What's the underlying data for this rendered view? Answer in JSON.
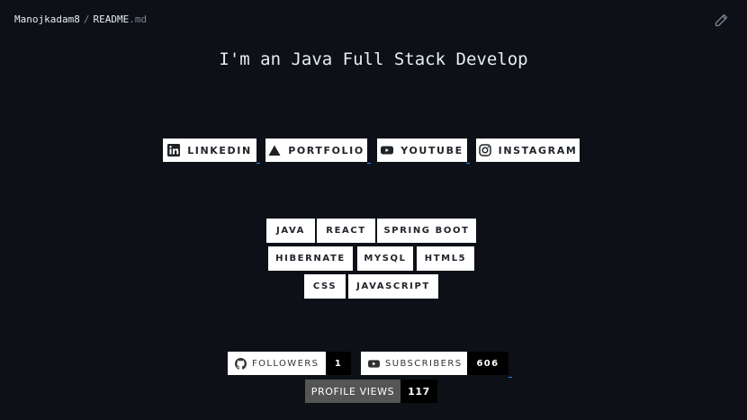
{
  "breadcrumb": {
    "user": "Manojkadam8",
    "separator": "/",
    "file": "README",
    "ext": ".md"
  },
  "title": "I'm an Java Full Stack Develop",
  "social_badges": [
    {
      "label": "LINKEDIN",
      "icon": "linkedin-icon"
    },
    {
      "label": "PORTFOLIO",
      "icon": "triangle-icon"
    },
    {
      "label": "YOUTUBE",
      "icon": "youtube-icon"
    },
    {
      "label": "INSTAGRAM",
      "icon": "instagram-icon"
    }
  ],
  "tech": {
    "row1": [
      "JAVA",
      "REACT",
      "SPRING BOOT"
    ],
    "row2": [
      "HIBERNATE",
      "MYSQL",
      "HTML5"
    ],
    "row3": [
      "CSS",
      "JAVASCRIPT"
    ]
  },
  "stats": {
    "followers": {
      "label": "FOLLOWERS",
      "count": "1",
      "icon": "github-icon"
    },
    "subscribers": {
      "label": "SUBSCRIBERS",
      "count": "606",
      "icon": "youtube-icon"
    },
    "profile_views": {
      "label": "PROFILE VIEWS",
      "count": "117"
    }
  },
  "colors": {
    "background": "#0d1117",
    "badge": "#ffffff",
    "link_underline": "#2f81f7"
  }
}
